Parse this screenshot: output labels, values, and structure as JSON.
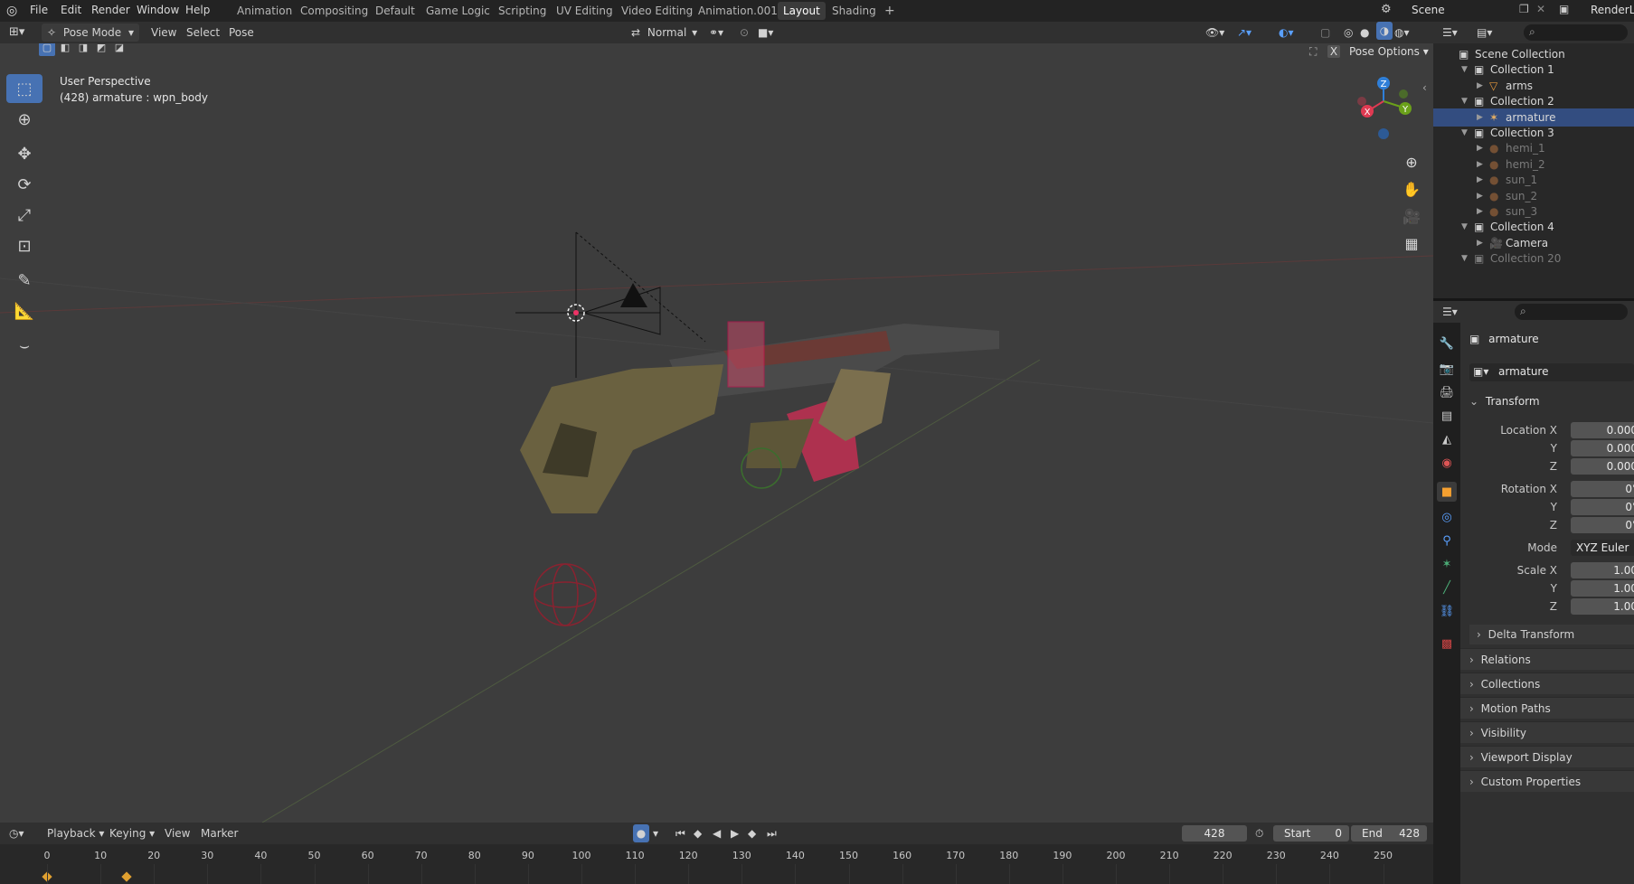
{
  "menu": {
    "items": [
      "File",
      "Edit",
      "Render",
      "Window",
      "Help"
    ]
  },
  "workspaces": {
    "tabs": [
      "Animation",
      "Compositing",
      "Default",
      "Game Logic",
      "Scripting",
      "UV Editing",
      "Video Editing",
      "Animation.001",
      "Layout",
      "Shading"
    ],
    "active": "Layout",
    "add": "+"
  },
  "scene": {
    "label": "Scene",
    "render_layer": "RenderLa"
  },
  "viewport_header": {
    "mode": "Pose Mode",
    "menus": [
      "View",
      "Select",
      "Pose"
    ],
    "orientation": "Normal",
    "pose_options": "Pose Options",
    "x_label": "X"
  },
  "viewport": {
    "perspective": "User Perspective",
    "object_info": "(428) armature : wpn_body",
    "gizmo": {
      "z": "Z",
      "y": "Y",
      "x": "X"
    }
  },
  "outliner": {
    "rows": [
      {
        "label": "Scene Collection",
        "indent": 0,
        "type": "scene"
      },
      {
        "label": "Collection 1",
        "indent": 1,
        "type": "collection"
      },
      {
        "label": "arms",
        "indent": 2,
        "type": "mesh"
      },
      {
        "label": "Collection 2",
        "indent": 1,
        "type": "collection"
      },
      {
        "label": "armature",
        "indent": 2,
        "type": "armature",
        "selected": true
      },
      {
        "label": "Collection 3",
        "indent": 1,
        "type": "collection"
      },
      {
        "label": "hemi_1",
        "indent": 2,
        "type": "light",
        "dim": true
      },
      {
        "label": "hemi_2",
        "indent": 2,
        "type": "light",
        "dim": true
      },
      {
        "label": "sun_1",
        "indent": 2,
        "type": "light",
        "dim": true
      },
      {
        "label": "sun_2",
        "indent": 2,
        "type": "light",
        "dim": true
      },
      {
        "label": "sun_3",
        "indent": 2,
        "type": "light",
        "dim": true
      },
      {
        "label": "Collection 4",
        "indent": 1,
        "type": "collection"
      },
      {
        "label": "Camera",
        "indent": 2,
        "type": "camera"
      },
      {
        "label": "Collection 20",
        "indent": 1,
        "type": "collection",
        "dim": true
      }
    ]
  },
  "properties": {
    "object_name": "armature",
    "datablock": "armature",
    "transform_title": "Transform",
    "location": {
      "label": "Location X",
      "x": "0.000",
      "y": "0.000",
      "z": "0.000"
    },
    "rotation": {
      "label": "Rotation X",
      "x": "0°",
      "y": "0°",
      "z": "0°"
    },
    "mode": {
      "label": "Mode",
      "value": "XYZ Euler"
    },
    "scale": {
      "label": "Scale X",
      "x": "1.00",
      "y": "1.00",
      "z": "1.00"
    },
    "axis_y": "Y",
    "axis_z": "Z",
    "delta": "Delta Transform",
    "panels": [
      "Relations",
      "Collections",
      "Motion Paths",
      "Visibility",
      "Viewport Display",
      "Custom Properties"
    ]
  },
  "timeline": {
    "menus": [
      "Playback",
      "Keying",
      "View",
      "Marker"
    ],
    "current_frame": "428",
    "start_label": "Start",
    "start": "0",
    "end_label": "End",
    "end": "428",
    "ticks": [
      "0",
      "10",
      "20",
      "30",
      "40",
      "50",
      "60",
      "70",
      "80",
      "90",
      "100",
      "110",
      "120",
      "130",
      "140",
      "150",
      "160",
      "170",
      "180",
      "190",
      "200",
      "210",
      "220",
      "230",
      "240",
      "250"
    ]
  },
  "colors": {
    "accent": "#4772b3",
    "selection": "#334d80",
    "x_axis": "#e03a52",
    "y_axis": "#6ba11a",
    "z_axis": "#2f7fd8"
  }
}
